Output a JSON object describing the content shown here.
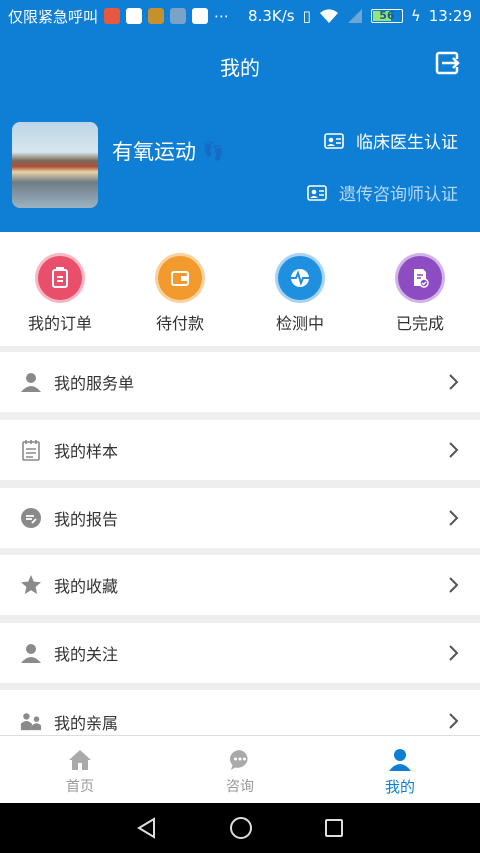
{
  "status_bar": {
    "left_text": "仅限紧急呼叫",
    "speed": "8.3K/s",
    "battery": "56",
    "time": "13:29"
  },
  "header": {
    "title": "我的",
    "username": "有氧运动",
    "cert_clinical": "临床医生认证",
    "cert_genetic": "遗传咨询师认证"
  },
  "orders": [
    {
      "label": "我的订单",
      "icon": "order-icon",
      "color": "#e94e6a"
    },
    {
      "label": "待付款",
      "icon": "wallet-icon",
      "color": "#f29a2e"
    },
    {
      "label": "检测中",
      "icon": "pulse-icon",
      "color": "#1f8fe0"
    },
    {
      "label": "已完成",
      "icon": "done-doc-icon",
      "color": "#8e4cc2"
    }
  ],
  "menu": [
    {
      "label": "我的服务单",
      "icon": "person-icon"
    },
    {
      "label": "我的样本",
      "icon": "notepad-icon"
    },
    {
      "label": "我的报告",
      "icon": "report-icon"
    },
    {
      "label": "我的收藏",
      "icon": "star-icon"
    },
    {
      "label": "我的关注",
      "icon": "person-icon"
    },
    {
      "label": "我的亲属",
      "icon": "family-icon"
    }
  ],
  "tabs": [
    {
      "label": "首页",
      "icon": "home-icon"
    },
    {
      "label": "咨询",
      "icon": "chat-icon"
    },
    {
      "label": "我的",
      "icon": "user-icon"
    }
  ],
  "colors": {
    "primary": "#0f7fd6",
    "menu_icon": "#8a8a8a"
  }
}
